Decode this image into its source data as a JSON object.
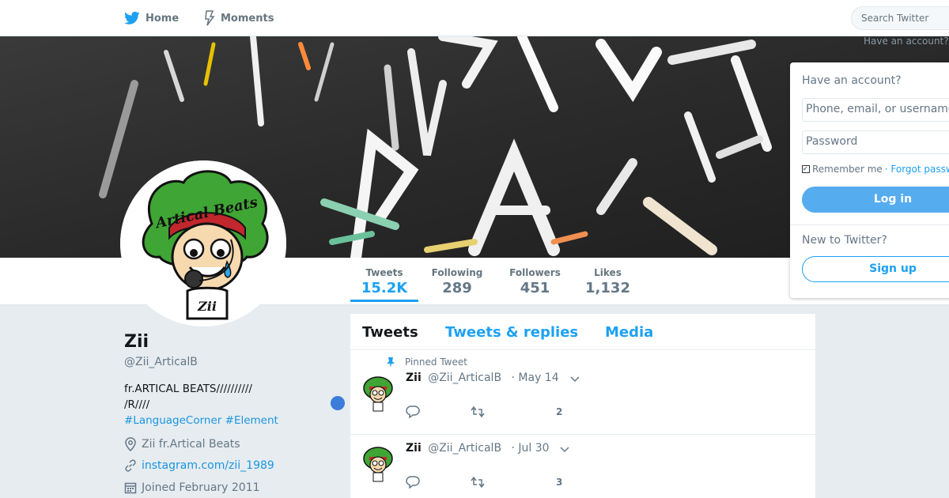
{
  "nav": {
    "home_label": "Home",
    "moments_label": "Moments",
    "search_placeholder": "Search Twitter",
    "have_account_faded": "Have an account?"
  },
  "profile": {
    "name": "Zii",
    "handle": "@Zii_ArticalB",
    "bio_line1": "fr.ARTICAL BEATS//////////",
    "bio_line2": "/R////",
    "bio_tags": "#LanguageCorner #Element",
    "location": "Zii fr.Artical Beats",
    "website": "instagram.com/zii_1989",
    "joined": "Joined February 2011",
    "avatar_text": "Artical Beats",
    "avatar_shirt_text": "Zii"
  },
  "stats": [
    {
      "label": "Tweets",
      "value": "15.2K"
    },
    {
      "label": "Following",
      "value": "289"
    },
    {
      "label": "Followers",
      "value": "451"
    },
    {
      "label": "Likes",
      "value": "1,132"
    }
  ],
  "tabs": [
    "Tweets",
    "Tweets & replies",
    "Media"
  ],
  "tweets": [
    {
      "pinned_label": "Pinned Tweet",
      "name": "Zii",
      "handle": "@Zii_ArticalB",
      "date": "· May 14",
      "likes": "2"
    },
    {
      "name": "Zii",
      "handle": "@Zii_ArticalB",
      "date": "· Jul 30",
      "likes": "3"
    }
  ],
  "login": {
    "heading": "Have an account?",
    "username_placeholder": "Phone, email, or username",
    "password_placeholder": "Password",
    "remember": "Remember me",
    "forgot": "· Forgot password?",
    "login_button": "Log in",
    "new_heading": "New to Twitter?",
    "signup_button": "Sign up"
  },
  "colors": {
    "accent": "#1da1f2",
    "login_button": "#55acee",
    "background": "#e6ecf0"
  }
}
